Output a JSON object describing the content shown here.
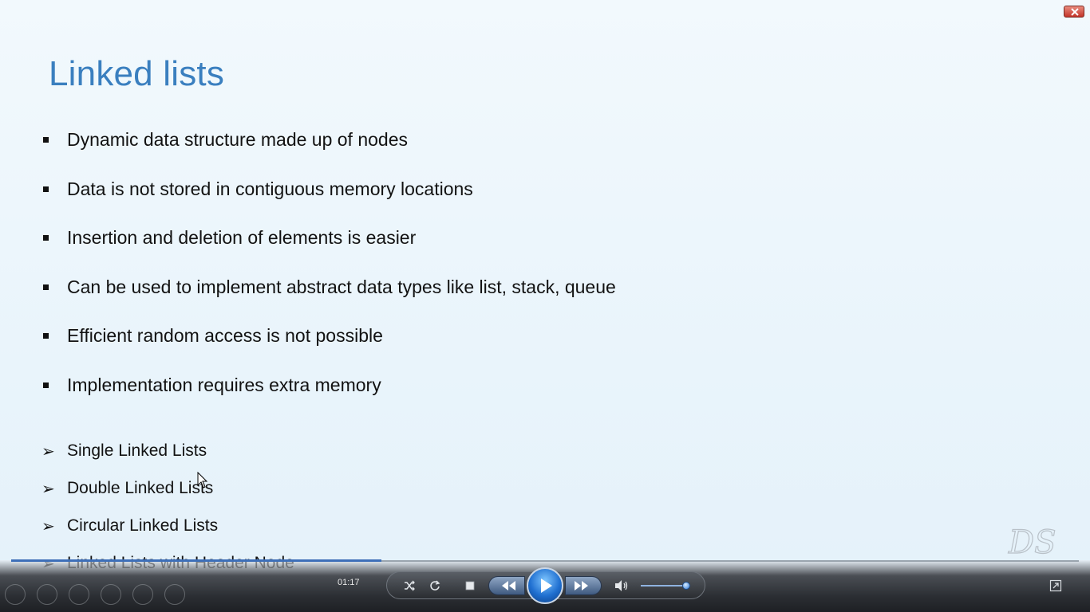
{
  "slide": {
    "title": "Linked lists",
    "bullets": [
      "Dynamic data structure made up of nodes",
      "Data is not stored in contiguous memory locations",
      "Insertion and deletion of elements is easier",
      "Can be used to implement abstract data types like list, stack, queue",
      "Efficient random access is not possible",
      "Implementation requires extra memory"
    ],
    "types": [
      "Single Linked Lists",
      "Double Linked Lists",
      "Circular Linked Lists",
      "Linked Lists with Header Node"
    ],
    "logo_text": "DS",
    "arrow_glyph": "➢"
  },
  "player": {
    "time": "01:17",
    "seek_progress_fraction": 0.347,
    "volume_fraction": 0.92,
    "icons": {
      "shuffle": "shuffle-icon",
      "repeat": "repeat-icon",
      "stop": "stop-icon",
      "previous": "previous-icon",
      "play": "play-icon",
      "next": "next-icon",
      "mute": "speaker-icon",
      "switch": "switch-to-library-icon"
    }
  },
  "window": {
    "close_icon": "close-icon"
  },
  "colors": {
    "title": "#3a7fbf",
    "text": "#121212",
    "close": "#c3352a",
    "seek": "#3d6fb8"
  }
}
